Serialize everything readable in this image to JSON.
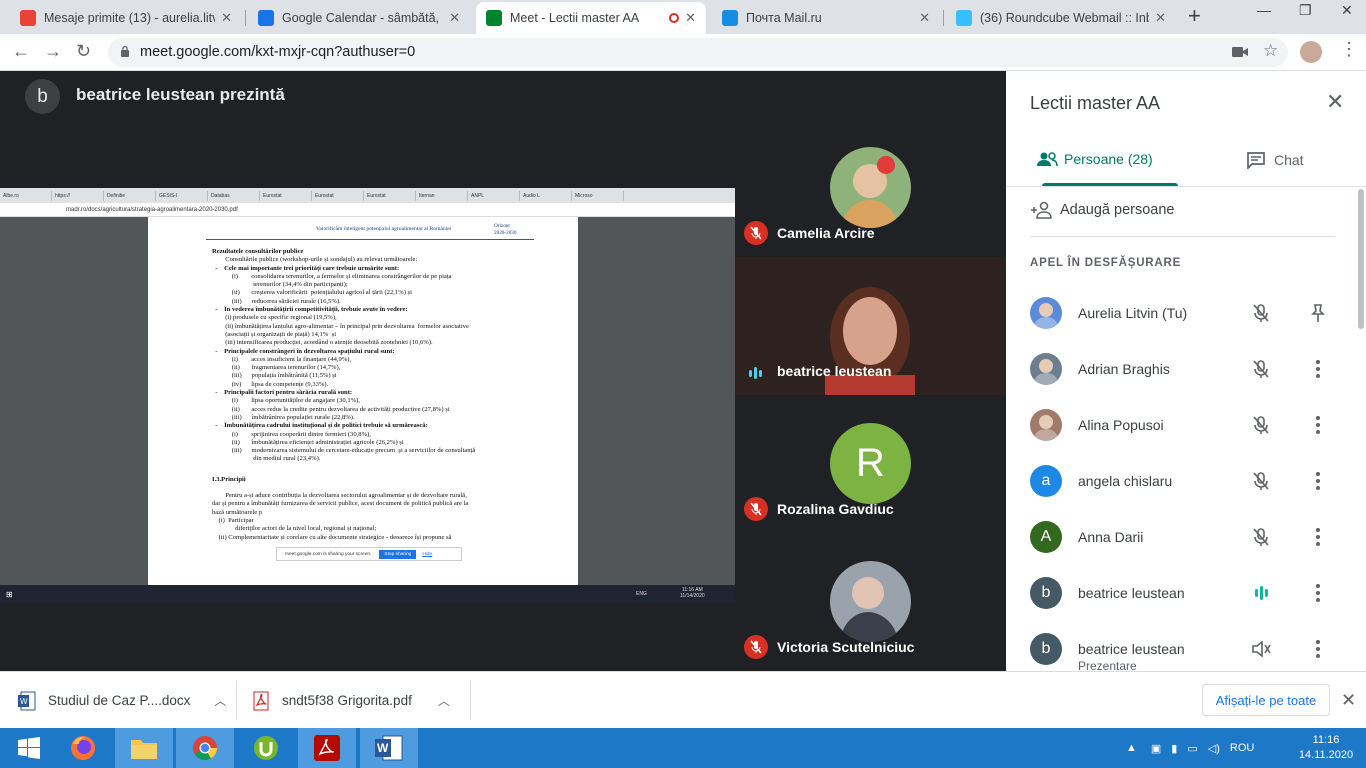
{
  "browser": {
    "tabs": [
      {
        "label": "Mesaje primite (13) - aurelia.litvi",
        "icon": "gmail-icon",
        "color": "#ea4335"
      },
      {
        "label": "Google Calendar - sâmbătă, 14 n",
        "icon": "calendar-icon",
        "color": "#1a73e8"
      },
      {
        "label": "Meet - Lectii master AA",
        "icon": "meet-icon",
        "color": "#00832d"
      },
      {
        "label": "Почта Mail.ru",
        "icon": "mailru-icon",
        "color": "#168de2"
      },
      {
        "label": "(36) Roundcube Webmail :: Inbo",
        "icon": "roundcube-icon",
        "color": "#37beff"
      }
    ],
    "url": "meet.google.com/kxt-mxjr-cqn?authuser=0"
  },
  "meet": {
    "presenter_initial": "b",
    "presenter_title": "beatrice leustean prezintă",
    "tiles": [
      {
        "name": "Camelia Arcire",
        "muted": true
      },
      {
        "name": "beatrice leustean",
        "muted": false
      },
      {
        "name": "Rozalina Gavdiuc",
        "muted": true,
        "initial": "R",
        "color": "#7cb342"
      },
      {
        "name": "Victoria Scutelniciuc",
        "muted": true
      }
    ]
  },
  "shared_screen": {
    "tabs": [
      "Albe.ro",
      "https://",
      "Definitie",
      "GESIS-I",
      "Databas",
      "Eurostat",
      "Eurostat",
      "Eurostat",
      "Iternan",
      "ANPL",
      "Audio L",
      "Microso"
    ],
    "url": "madr.ro/docs/agricultura/strategia-agroalimentara-2020-2030.pdf",
    "doc_header_left": "Valorificăm inteligent potențialul agroalimentar al României",
    "doc_header_right_1": "Orizont",
    "doc_header_right_2": "2020-2030",
    "lines": [
      {
        "t": "Rezultatele consultărilor publice",
        "b": true,
        "gap": 8
      },
      {
        "t": "        Consultările publice (workshop-urile și sondajul) au relevat următoarele:",
        "b": false
      },
      {
        "t": "  -    Cele mai importante trei priorități care trebuie urmărite sunt:",
        "b": true
      },
      {
        "t": "            (i)        consolidarea terenurilor, a fermelor și eliminarea constrângerilor de pe piața",
        "b": false
      },
      {
        "t": "                         terenurilor (34,4% din participanți);",
        "b": false
      },
      {
        "t": "            (ii)       creșterea valorificării  potențialului agricol al țării (22,1%) și",
        "b": false
      },
      {
        "t": "            (iii)      reducerea sărăciei rurale (16,5%).",
        "b": false
      },
      {
        "t": "  -    În vederea îmbunătățirii competitivității, trebuie avute în vedere:",
        "b": true
      },
      {
        "t": "        (i) produsele cu specific regional (19,5%),",
        "b": false
      },
      {
        "t": "        (ii) îmbunătățirea lanțului agro-alimentar – în principal prin dezvoltarea  formelor asociative",
        "b": false
      },
      {
        "t": "        (asociații și organizații de piață) 14,1%  și",
        "b": false
      },
      {
        "t": "        (iii) intensificarea producției, acordând o atenție deosebită zootehniei (10,6%).",
        "b": false
      },
      {
        "t": "  -    Principalele constrângeri în dezvoltarea spațiului rural sunt:",
        "b": true
      },
      {
        "t": "            (i)        acces insuficient la finanțare (44,9%),",
        "b": false
      },
      {
        "t": "            (ii)       fragmentarea terenurilor (14,7%),",
        "b": false
      },
      {
        "t": "            (iii)      populația îmbătrânită (11,5%) și",
        "b": false
      },
      {
        "t": "            (iv)      lipsa de competențe (9,33%).",
        "b": false
      },
      {
        "t": "  -    Principalii factori pentru sărăcia rurală sunt:",
        "b": true
      },
      {
        "t": "            (i)        lipsa oportunităților de angajare (30,1%),",
        "b": false
      },
      {
        "t": "            (ii)       acces redus la credite pentru dezvoltarea de activități productive (27,8%) și",
        "b": false
      },
      {
        "t": "            (iii)      îmbătrânirea populației rurale (22,8%).",
        "b": false
      },
      {
        "t": "  -    Îmbunătățirea cadrului instituțional și de politici trebuie să urmărească:",
        "b": true
      },
      {
        "t": "            (i)        sprijinirea cooperării dintre fermieri (30,8%),",
        "b": false
      },
      {
        "t": "            (ii)       îmbunătățirea eficienței administrației agricole (26,2%) și",
        "b": false
      },
      {
        "t": "            (iii)      modernizarea sistemului de cercetare-educație precum  și a serviciilor de consultanță",
        "b": false
      },
      {
        "t": "                         din mediul rural (23,4%).",
        "b": false
      },
      {
        "t": "I.3.Principii",
        "b": true,
        "gap": 12
      },
      {
        "t": "        Pentru a-și aduce contribuția la dezvoltarea sectorului agroalimentar și de dezvoltare rurală,",
        "b": false,
        "gap": 8
      },
      {
        "t": "dar și pentru a îmbunătăți furnizarea de servicii publice, acest document de politică publică are la",
        "b": false
      },
      {
        "t": "bază următoarele p",
        "b": false
      },
      {
        "t": "    (i)  Participar",
        "b": false
      },
      {
        "t": "              diferiților actori de la nivel local, regional și național;",
        "b": false
      },
      {
        "t": "    (ii) Complementaritate și corelare cu alte documente strategice - deoarece își propune să",
        "b": false
      }
    ],
    "share_notice": "meet.google.com is sharing your screen.",
    "stop_sharing": "Stop sharing",
    "hide": "Hide",
    "mini_time": "11:16 AM",
    "mini_date": "11/14/2020",
    "mini_lang": "ENG"
  },
  "panel": {
    "title": "Lectii master AA",
    "tab_people": "Persoane (28)",
    "tab_chat": "Chat",
    "add_people": "Adaugă persoane",
    "section": "APEL ÎN DESFĂȘURARE",
    "people": [
      {
        "name": "Aurelia Litvin (Tu)",
        "sub": "",
        "initial": "",
        "color": "#5b8bd9",
        "action": "pin-icon"
      },
      {
        "name": "Adrian Braghis",
        "sub": "",
        "initial": "",
        "color": "#6d7e8e",
        "action": "more-icon"
      },
      {
        "name": "Alina Popusoi",
        "sub": "",
        "initial": "",
        "color": "#a07a6a",
        "action": "more-icon"
      },
      {
        "name": "angela chislaru",
        "sub": "",
        "initial": "a",
        "color": "#1e88e5",
        "action": "more-icon"
      },
      {
        "name": "Anna Darii",
        "sub": "",
        "initial": "A",
        "color": "#33691e",
        "action": "more-icon"
      },
      {
        "name": "beatrice leustean",
        "sub": "",
        "initial": "b",
        "color": "#455a64",
        "action": "more-icon",
        "speaking": true
      },
      {
        "name": "beatrice leustean",
        "sub": "Prezentare",
        "initial": "b",
        "color": "#455a64",
        "action": "more-icon",
        "presentation": true
      }
    ]
  },
  "downloads": {
    "items": [
      {
        "name": "Studiul de Caz P....docx",
        "icon": "word-doc-icon"
      },
      {
        "name": "sndt5f38 Grigorita.pdf",
        "icon": "pdf-icon"
      }
    ],
    "show_all": "Afișați-le pe toate"
  },
  "taskbar": {
    "lang": "ROU",
    "time": "11:16",
    "date": "14.11.2020"
  }
}
